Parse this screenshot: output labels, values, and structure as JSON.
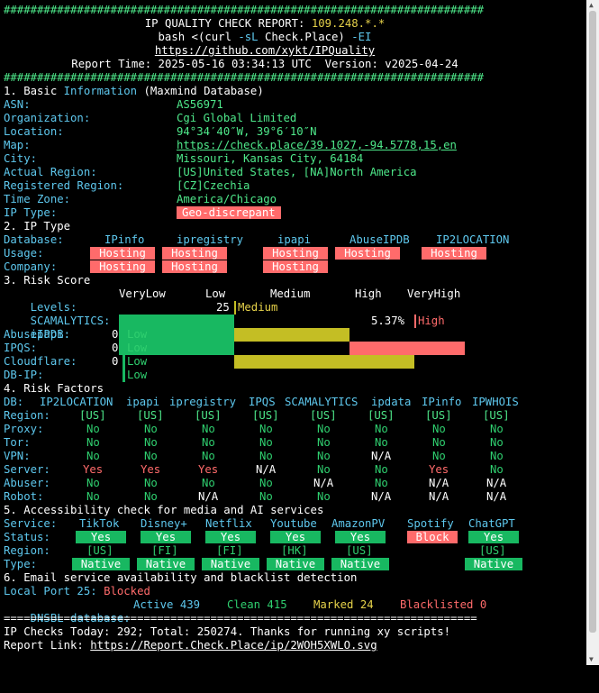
{
  "rule": "########################################################################",
  "rule2": "=======================================================================",
  "header": {
    "title_prefix": "IP QUALITY CHECK REPORT: ",
    "ip": "109.248.*.*",
    "cmd_a": "bash <(curl ",
    "cmd_flag": "-sL",
    "cmd_b": " Check.Place) ",
    "cmd_flag2": "-EI",
    "link": "https://github.com/xykt/IPQuality",
    "time": "Report Time: 2025-05-16 03:34:13 UTC  Version: v2025-04-24"
  },
  "basic": {
    "head_a": "1. Basic ",
    "head_b": "Information",
    "head_c": " (Maxmind Database)",
    "rows": [
      {
        "k": "ASN:",
        "v": "AS56971"
      },
      {
        "k": "Organization:",
        "v": "Cgi Global Limited"
      },
      {
        "k": "Location:",
        "v": "94°34′40″W, 39°6′10″N"
      },
      {
        "k": "Map:",
        "v": "https://check.place/39.1027,-94.5778,15,en"
      },
      {
        "k": "City:",
        "v": "Missouri, Kansas City, 64184"
      },
      {
        "k": "Actual Region:",
        "v": "[US]United States, [NA]North America"
      },
      {
        "k": "Registered Region:",
        "v": "[CZ]Czechia"
      },
      {
        "k": "Time Zone:",
        "v": "America/Chicago"
      },
      {
        "k": "IP Type:",
        "v": "Geo-discrepant"
      }
    ]
  },
  "iptype": {
    "head": "2. IP Type",
    "db_label": "Database:",
    "usage_label": "Usage:",
    "company_label": "Company:",
    "dbs": [
      "IPinfo",
      "ipregistry",
      "ipapi",
      "AbuseIPDB",
      "IP2LOCATION"
    ],
    "usage": [
      "Hosting",
      "Hosting",
      "Hosting",
      "Hosting",
      "Hosting"
    ],
    "company": [
      "Hosting",
      "Hosting",
      "Hosting",
      "",
      ""
    ]
  },
  "risk": {
    "head": "3. Risk Score",
    "levels_label": "Levels:",
    "levels": [
      "VeryLow",
      "Low",
      "Medium",
      "High",
      "VeryHigh"
    ],
    "scam_label": "SCAMALYTICS:",
    "scam_score": "25",
    "scam_level": "Medium",
    "scam_fraction": 0.25,
    "ipapi_label": "ipapi:",
    "ipapi_score": "5.37%",
    "ipapi_level": "High",
    "ipapi_fraction": 0.52,
    "small": [
      {
        "k": "AbuseIPDB:",
        "s": "0",
        "l": "Low"
      },
      {
        "k": "IPQS:",
        "s": "0",
        "l": "Low"
      },
      {
        "k": "Cloudflare:",
        "s": "0",
        "l": "Low"
      },
      {
        "k": "DB-IP:",
        "s": "",
        "l": "Low"
      }
    ]
  },
  "factors": {
    "head": "4. Risk Factors",
    "db_label": "DB:",
    "cols": [
      "IP2LOCATION",
      "ipapi",
      "ipregistry",
      "IPQS",
      "SCAMALYTICS",
      "ipdata",
      "IPinfo",
      "IPWHOIS"
    ],
    "rows": [
      {
        "k": "Region:",
        "v": [
          "[US]",
          "[US]",
          "[US]",
          "[US]",
          "[US]",
          "[US]",
          "[US]",
          "[US]"
        ]
      },
      {
        "k": "Proxy:",
        "v": [
          "No",
          "No",
          "No",
          "No",
          "No",
          "No",
          "No",
          "No"
        ]
      },
      {
        "k": "Tor:",
        "v": [
          "No",
          "No",
          "No",
          "No",
          "No",
          "No",
          "No",
          "No"
        ]
      },
      {
        "k": "VPN:",
        "v": [
          "No",
          "No",
          "No",
          "No",
          "No",
          "N/A",
          "No",
          "No"
        ]
      },
      {
        "k": "Server:",
        "v": [
          "Yes",
          "Yes",
          "Yes",
          "N/A",
          "No",
          "No",
          "Yes",
          "No"
        ]
      },
      {
        "k": "Abuser:",
        "v": [
          "No",
          "No",
          "No",
          "No",
          "N/A",
          "No",
          "N/A",
          "N/A"
        ]
      },
      {
        "k": "Robot:",
        "v": [
          "No",
          "No",
          "N/A",
          "No",
          "No",
          "N/A",
          "N/A",
          "N/A"
        ]
      }
    ]
  },
  "media": {
    "head": "5. Accessibility check for media and AI services",
    "service_label": "Service:",
    "status_label": "Status:",
    "region_label": "Region:",
    "type_label": "Type:",
    "services": [
      "TikTok",
      "Disney+",
      "Netflix",
      "Youtube",
      "AmazonPV",
      "Spotify",
      "ChatGPT"
    ],
    "status": [
      "Yes",
      "Yes",
      "Yes",
      "Yes",
      "Yes",
      "Block",
      "Yes"
    ],
    "region": [
      "[US]",
      "[FI]",
      "[FI]",
      "[HK]",
      "[US]",
      "",
      "[US]"
    ],
    "type": [
      "Native",
      "Native",
      "Native",
      "Native",
      "Native",
      "",
      "Native"
    ]
  },
  "email": {
    "head": "6. Email service availability and blacklist detection",
    "port_label": "Local Port 25: ",
    "port_value": "Blocked",
    "dnsbl_label": "DNSBL database: ",
    "active": "Active 439",
    "clean": "Clean 415",
    "marked": "Marked 24",
    "blacklisted": "Blacklisted 0"
  },
  "footer": {
    "checks": "IP Checks Today: 292; Total: 250274. Thanks for running xy scripts!",
    "report_label": "Report Link: ",
    "report_link": "https://Report.Check.Place/ip/2WOH5XWLO.svg"
  }
}
